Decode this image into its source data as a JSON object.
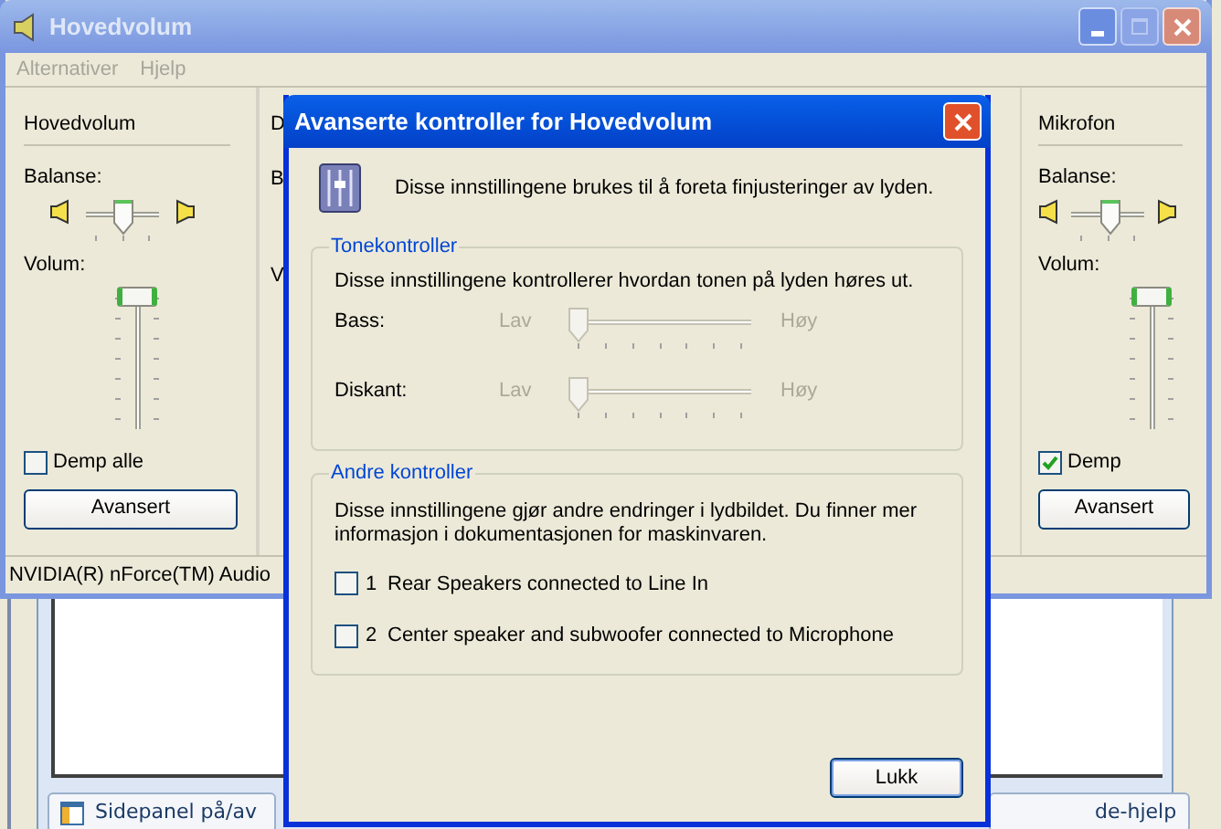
{
  "background_window": {
    "buttons": [
      {
        "label": "Sidepanel på/av"
      },
      {
        "label": "de-hjelp"
      }
    ]
  },
  "window": {
    "title": "Hovedvolum",
    "menu": [
      "Alternativer",
      "Hjelp"
    ],
    "channels": [
      {
        "name": "Hovedvolum",
        "balance_label": "Balanse:",
        "balance": {
          "level": 0.5
        },
        "volume_label": "Volum:",
        "volume": {
          "level": 1
        },
        "mute_label": "Demp alle",
        "muted": false,
        "button": "Avansert"
      },
      {
        "name": "D",
        "balance_label": "B",
        "volume_label": "V",
        "kind": "partial"
      },
      {
        "name": "Mikrofon",
        "balance_label": "Balanse:",
        "balance": {
          "level": 0.55
        },
        "volume_label": "Volum:",
        "volume": {
          "level": 1
        },
        "mute_label": "Demp",
        "muted": true,
        "button": "Avansert"
      }
    ],
    "status_bar": "NVIDIA(R) nForce(TM) Audio"
  },
  "dialog": {
    "title": "Avanserte kontroller for Hovedvolum",
    "intro": "Disse innstillingene brukes til å foreta finjusteringer av lyden.",
    "tone_group": {
      "title": "Tonekontroller",
      "description": "Disse innstillingene kontrollerer hvordan tonen på lyden høres ut.",
      "sliders": [
        {
          "label": "Bass:",
          "low": "Lav",
          "high": "Høy",
          "level": 0,
          "disabled": true
        },
        {
          "label": "Diskant:",
          "low": "Lav",
          "high": "Høy",
          "level": 0,
          "disabled": true
        }
      ]
    },
    "other_group": {
      "title": "Andre kontroller",
      "description": "Disse innstillingene gjør andre endringer i lydbildet. Du finner mer informasjon i dokumentasjonen for maskinvaren.",
      "options": [
        {
          "number": "1",
          "label": "Rear Speakers connected to Line In",
          "checked": false
        },
        {
          "number": "2",
          "label": "Center speaker and subwoofer connected to Microphone",
          "checked": false
        }
      ]
    },
    "button": "Lukk"
  }
}
